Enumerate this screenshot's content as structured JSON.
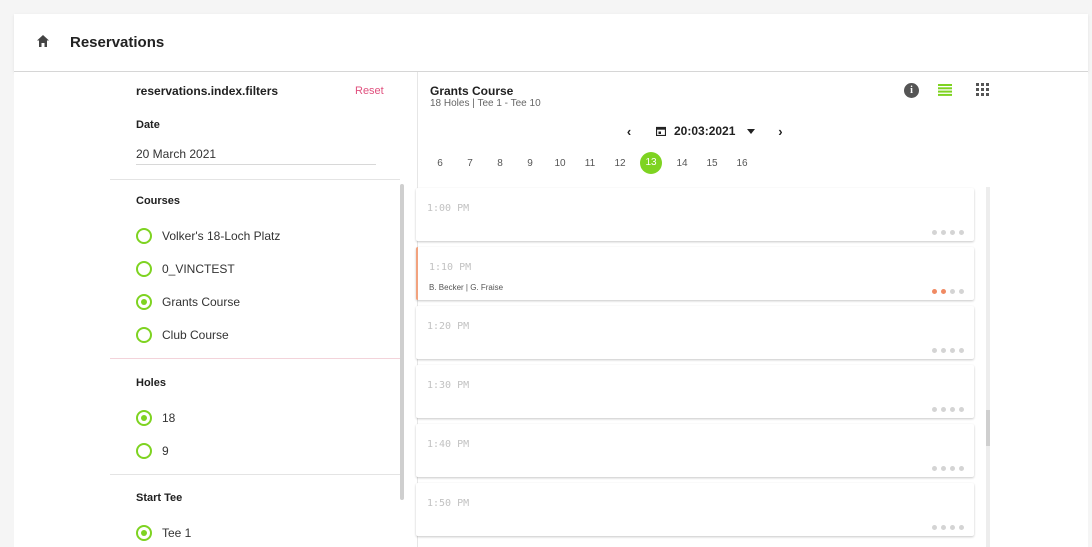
{
  "header": {
    "title": "Reservations",
    "home_icon": "home-icon"
  },
  "filters": {
    "title": "reservations.index.filters",
    "reset_label": "Reset",
    "date": {
      "label": "Date",
      "value": "20 March 2021"
    },
    "courses": {
      "label": "Courses",
      "options": [
        {
          "label": "Volker's 18-Loch Platz",
          "selected": false
        },
        {
          "label": "0_VINCTEST",
          "selected": false
        },
        {
          "label": "Grants Course",
          "selected": true
        },
        {
          "label": "Club Course",
          "selected": false
        }
      ]
    },
    "holes": {
      "label": "Holes",
      "options": [
        {
          "label": "18",
          "selected": true
        },
        {
          "label": "9",
          "selected": false
        }
      ]
    },
    "start_tee": {
      "label": "Start Tee",
      "options": [
        {
          "label": "Tee 1",
          "selected": true
        }
      ]
    }
  },
  "course_header": {
    "name": "Grants Course",
    "subtitle": "18 Holes | Tee 1 - Tee 10"
  },
  "date_nav": {
    "prev": "‹",
    "next": "›",
    "date": "20:03:2021"
  },
  "hours": {
    "items": [
      "6",
      "7",
      "8",
      "9",
      "10",
      "11",
      "12",
      "13",
      "14",
      "15",
      "16"
    ],
    "active": "13"
  },
  "slots": [
    {
      "time": "1:00 PM",
      "players": "",
      "filled": 0
    },
    {
      "time": "1:10 PM",
      "players": "B. Becker | G. Fraise",
      "filled": 2
    },
    {
      "time": "1:20 PM",
      "players": "",
      "filled": 0
    },
    {
      "time": "1:30 PM",
      "players": "",
      "filled": 0
    },
    {
      "time": "1:40 PM",
      "players": "",
      "filled": 0
    },
    {
      "time": "1:50 PM",
      "players": "",
      "filled": 0
    }
  ],
  "colors": {
    "accent": "#7ed321",
    "reset": "#e0507e",
    "booked": "#f08a63"
  }
}
